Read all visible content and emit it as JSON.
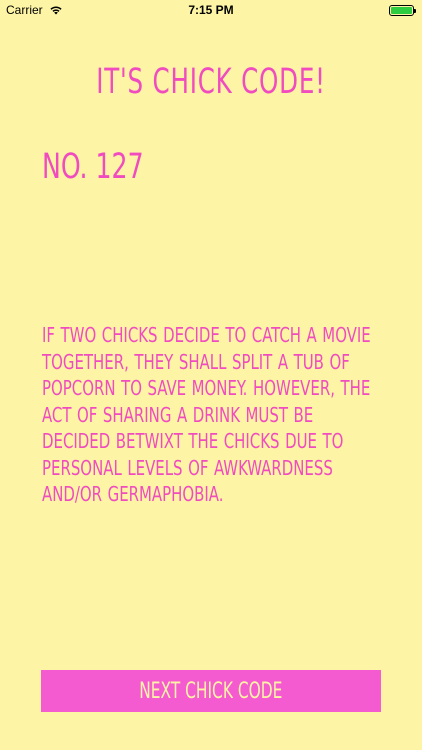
{
  "status_bar": {
    "carrier": "Carrier",
    "time": "7:15 PM"
  },
  "title": "IT'S CHICK CODE!",
  "code_number": "NO. 127",
  "code_text": "IF TWO CHICKS DECIDE TO CATCH A MOVIE TOGETHER, THEY SHALL SPLIT A TUB OF POPCORN TO SAVE MONEY. HOWEVER, THE ACT OF SHARING A DRINK MUST BE DECIDED BETWIXT THE CHICKS DUE TO PERSONAL LEVELS OF AWKWARDNESS AND/OR GERMAPHOBIA.",
  "next_button_label": "NEXT CHICK CODE",
  "colors": {
    "background": "#fdf5a5",
    "accent_pink": "#f04cbf",
    "button_pink": "#f55bd0",
    "button_text": "#fdf5a5"
  }
}
